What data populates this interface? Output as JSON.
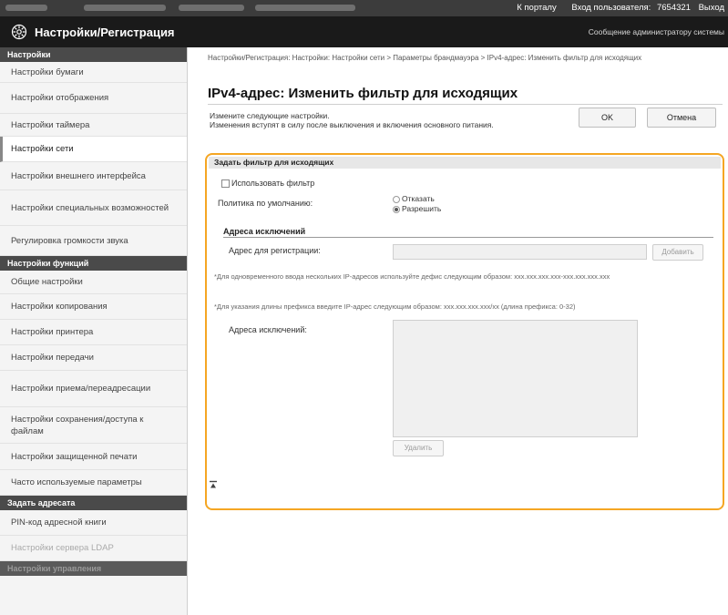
{
  "topbar": {
    "links": [
      "К порталу",
      "Вход пользователя:",
      "7654321",
      "Выход"
    ]
  },
  "header": {
    "title": "Настройки/Регистрация",
    "admin_message": "Сообщение администратору системы"
  },
  "sidebar": {
    "groups": [
      {
        "label": "Настройки",
        "items": [
          {
            "label": "Настройки бумаги"
          },
          {
            "label": "Настройки отображения"
          },
          {
            "label": "Настройки таймера"
          },
          {
            "label": "Настройки сети",
            "active": true
          },
          {
            "label": "Настройки внешнего интерфейса"
          },
          {
            "label": "Настройки специальных возможностей"
          },
          {
            "label": "Регулировка громкости звука"
          }
        ]
      },
      {
        "label": "Настройки функций",
        "items": [
          {
            "label": "Общие настройки"
          },
          {
            "label": "Настройки копирования"
          },
          {
            "label": "Настройки принтера"
          },
          {
            "label": "Настройки передачи"
          },
          {
            "label": "Настройки приема/переадресации"
          },
          {
            "label": "Настройки сохранения/доступа к файлам"
          },
          {
            "label": "Настройки защищенной печати"
          },
          {
            "label": "Часто используемые параметры"
          }
        ]
      },
      {
        "label": "Задать адресата",
        "items": [
          {
            "label": "PIN-код адресной книги"
          },
          {
            "label": "Настройки сервера LDAP"
          }
        ]
      },
      {
        "label": "Настройки управления",
        "items": []
      }
    ]
  },
  "main": {
    "breadcrumb": "Настройки/Регистрация: Настройки: Настройки сети > Параметры брандмауэра > IPv4-адрес: Изменить фильтр для исходящих",
    "page_title": "IPv4-адрес: Изменить фильтр для исходящих",
    "description": "Измените следующие настройки.\nИзменения вступят в силу после выключения и включения основного питания.",
    "ok_label": "OK",
    "cancel_label": "Отмена"
  },
  "filter_section": {
    "header": "Задать фильтр для исходящих",
    "use_filter_label": "Использовать фильтр",
    "use_filter_checked": false,
    "default_policy_label": "Политика по умолчанию:",
    "policy_options": [
      "Отказать",
      "Разрешить"
    ],
    "policy_selected": "Разрешить",
    "exceptions_header": "Адреса исключений",
    "register_label": "Адрес для регистрации:",
    "register_value": "",
    "add_button": "Добавить",
    "note_1": "*Для одновременного ввода нескольких IP-адресов используйте дефис следующим образом: xxx.xxx.xxx.xxx-xxx.xxx.xxx.xxx",
    "note_2": "*Для указания длины префикса введите IP-адрес следующим образом: xxx.xxx.xxx.xxx/xx (длина префикса: 0-32)",
    "exceptions_list_label": "Адреса исключений:",
    "delete_button": "Удалить"
  },
  "icons": {
    "logo": "gear-icon",
    "to_top": "to-top-icon"
  },
  "colors": {
    "highlight_border": "#f5a623",
    "header_bg": "#1a1a1a",
    "topbar_bg": "#3c3c3c"
  }
}
